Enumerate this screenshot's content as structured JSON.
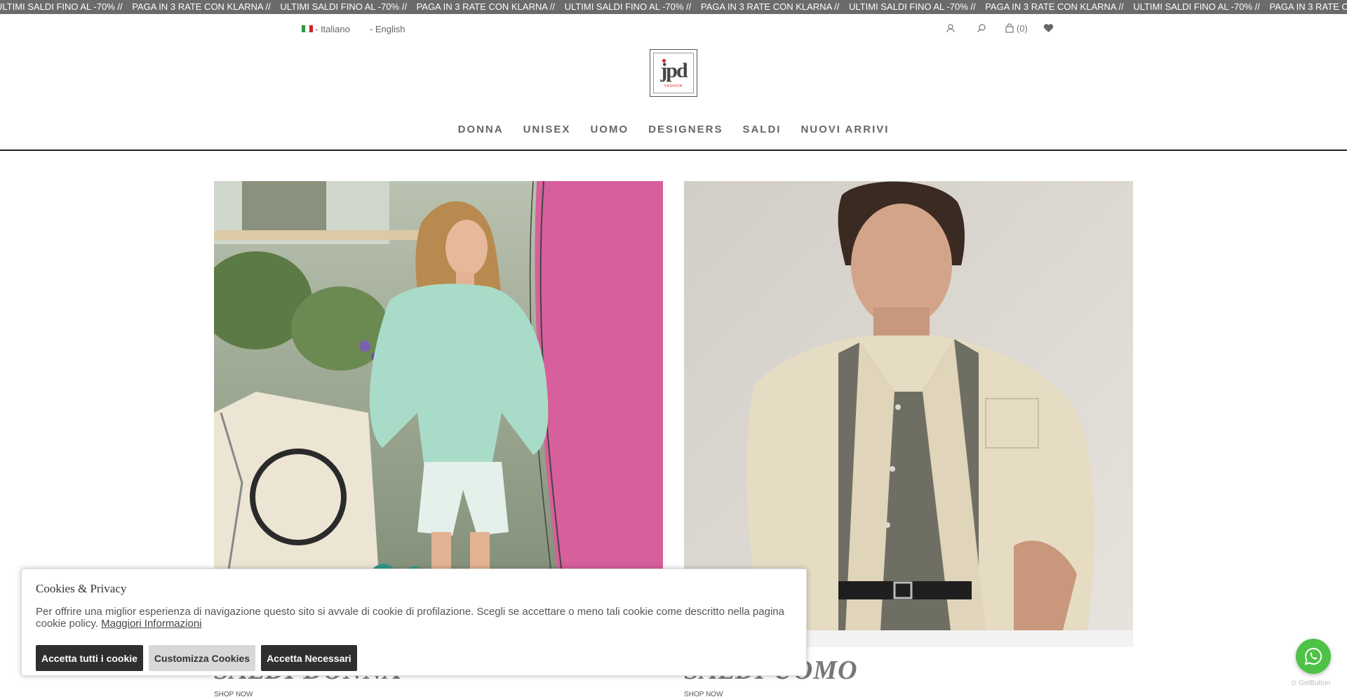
{
  "ticker": {
    "items": [
      "ULTIMI SALDI FINO AL -70% //",
      "PAGA IN 3 RATE CON KLARNA //",
      "ULTIMI SALDI FINO AL -70% //",
      "PAGA IN 3 RATE CON KLARNA //",
      "ULTIMI SALDI FINO AL -70% //",
      "PAGA IN 3 RATE CON KLARNA //",
      "ULTIMI SALDI FINO AL -70% //",
      "PAGA IN 3 RATE CON KLARNA //",
      "ULTIMI SALDI FINO AL -70% //",
      "PAGA IN 3 RATE CON KLARNA //"
    ]
  },
  "language": {
    "italian": "- Italiano",
    "english": "- English"
  },
  "header": {
    "cart_count": "(0)",
    "logo_text": "jpd",
    "logo_sub": "FASHION"
  },
  "nav": {
    "items": [
      "DONNA",
      "UNISEX",
      "UOMO",
      "DESIGNERS",
      "SALDI",
      "NUOVI ARRIVI"
    ]
  },
  "promos": {
    "women": {
      "title": "SALDI DONNA",
      "link": "SHOP NOW"
    },
    "men": {
      "title": "SALDI UOMO",
      "link": "SHOP NOW"
    }
  },
  "cookie": {
    "title": "Cookies & Privacy",
    "text": "Per offrire una miglior esperienza di navigazione questo sito si avvale di cookie di profilazione. Scegli se accettare o meno tali cookie come descritto nella pagina cookie policy.",
    "link": "Maggiori Informazioni",
    "accept_all": "Accetta tutti i cookie",
    "customize": "Customizza Cookies",
    "accept_necessary": "Accetta Necessari"
  },
  "widget": {
    "credit": "GetButton"
  },
  "colors": {
    "ticker_bg": "#6b6b6b",
    "whatsapp": "#4dc247",
    "button_dark": "#2f2f2f",
    "logo_red": "#d2232a"
  }
}
